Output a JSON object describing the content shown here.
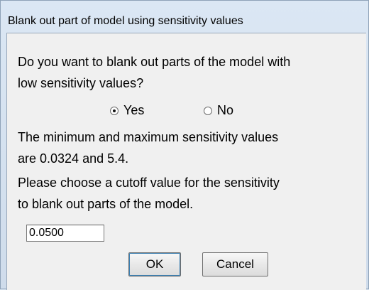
{
  "window": {
    "title": "Blank out part of model using sensitivity values"
  },
  "dialog": {
    "question_line1": "Do you want to blank out parts of the model with",
    "question_line2": "low sensitivity values?",
    "radio_yes_label": "Yes",
    "radio_no_label": "No",
    "selected_option": "Yes",
    "info_line1": "The minimum and maximum sensitivity values",
    "info_line2": "are 0.0324 and 5.4.",
    "info_line3": "Please choose a cutoff value for the sensitivity",
    "info_line4": "to blank out parts of the model.",
    "cutoff_value": "0.0500",
    "ok_label": "OK",
    "cancel_label": "Cancel"
  }
}
